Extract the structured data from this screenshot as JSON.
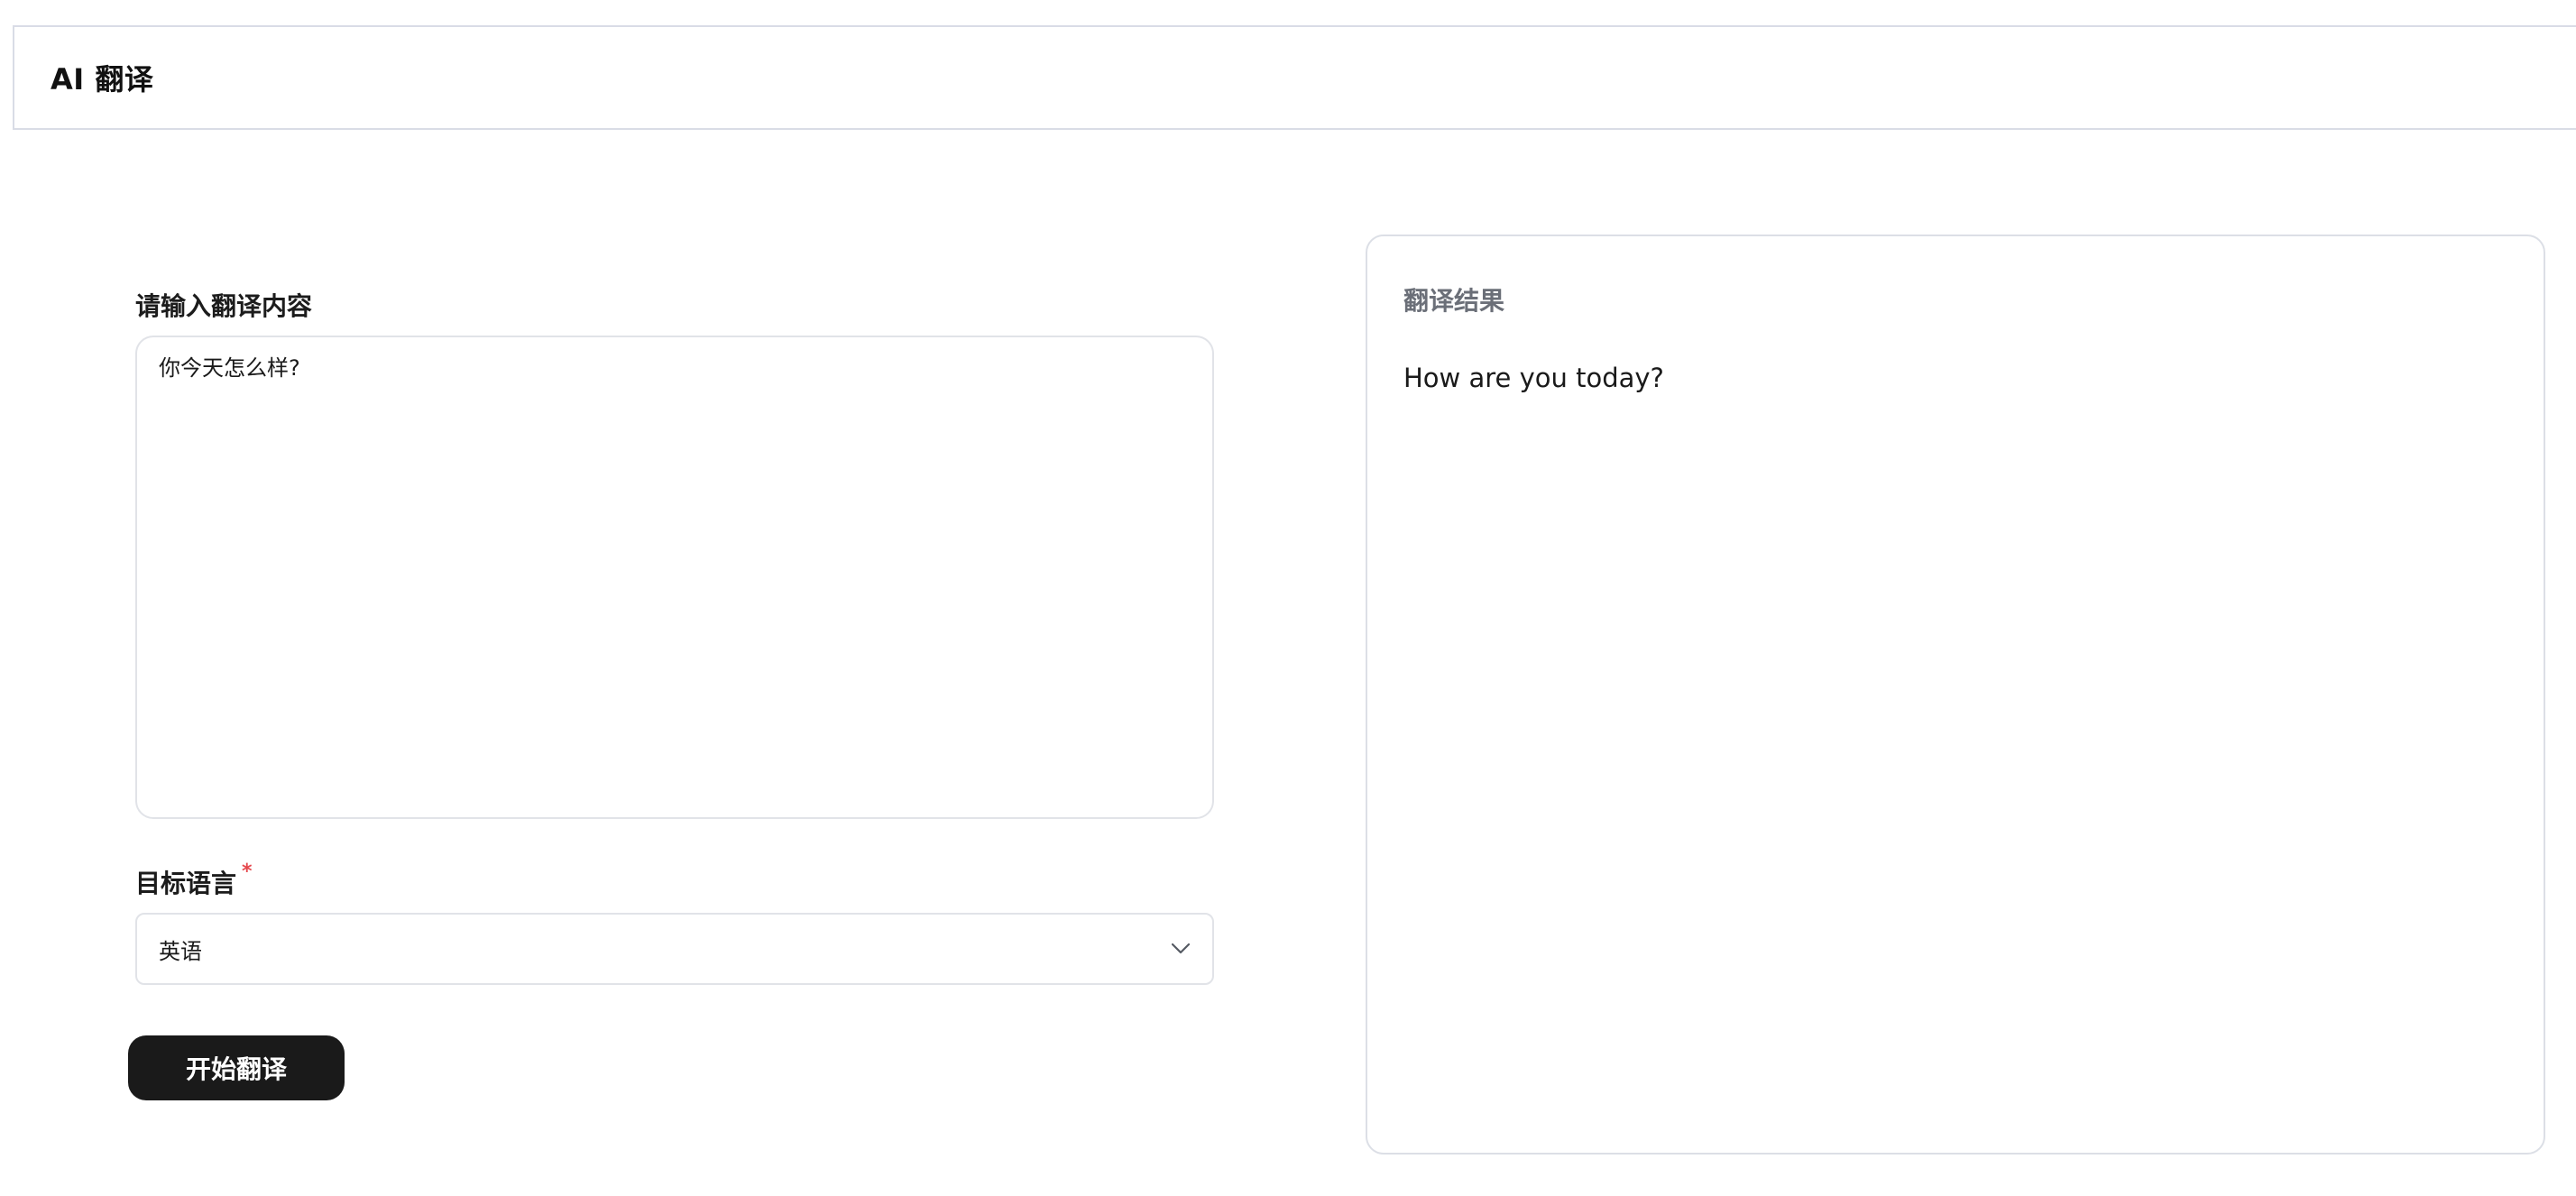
{
  "header": {
    "title": "AI 翻译"
  },
  "form": {
    "input_label": "请输入翻译内容",
    "input_value": "你今天怎么样?",
    "target_label": "目标语言",
    "required_mark": "*",
    "target_value": "英语",
    "submit_label": "开始翻译"
  },
  "result": {
    "title": "翻译结果",
    "text": "How are you today?"
  },
  "colors": {
    "button_bg": "#1a1a1a",
    "required": "#e5484d",
    "border": "#e1e3e8",
    "result_title": "#6b6f78"
  }
}
